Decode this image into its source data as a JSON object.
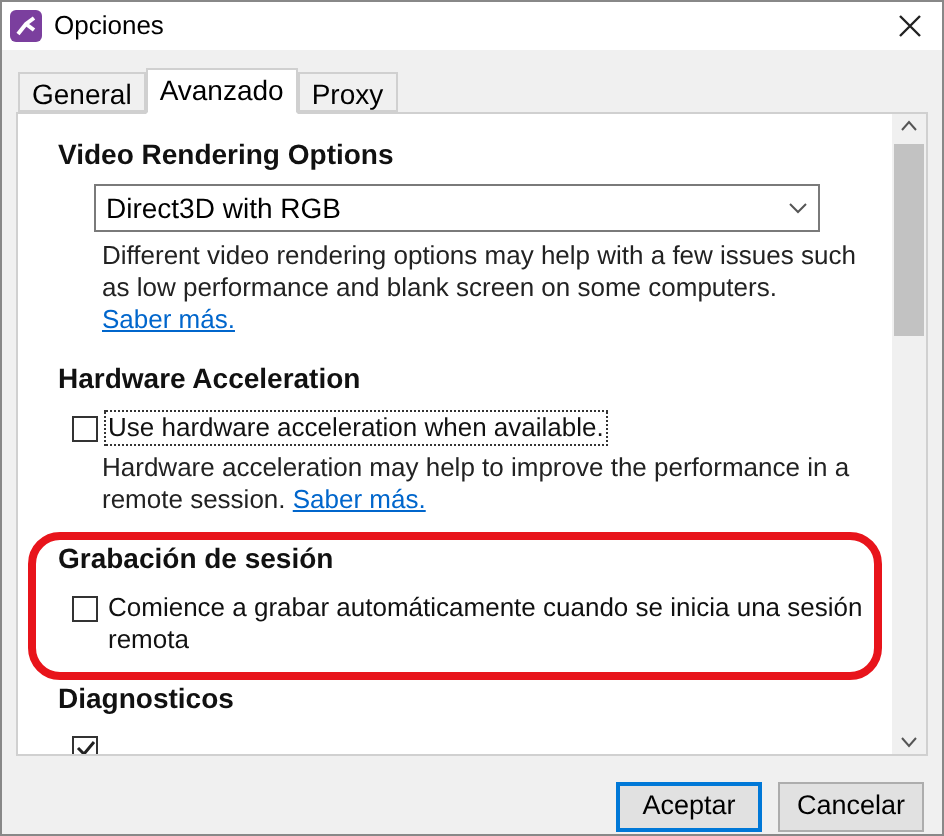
{
  "window": {
    "title": "Opciones"
  },
  "tabs": [
    {
      "label": "General",
      "selected": false
    },
    {
      "label": "Avanzado",
      "selected": true
    },
    {
      "label": "Proxy",
      "selected": false
    }
  ],
  "sections": [
    {
      "heading": "Video Rendering Options",
      "items": [
        {
          "kind": "dropdown",
          "value": "Direct3D with RGB"
        },
        {
          "kind": "note",
          "text": "Different video rendering options may help with a few issues such as low performance and blank screen on some computers. ",
          "link": "Saber más."
        }
      ]
    },
    {
      "heading": "Hardware Acceleration",
      "items": [
        {
          "kind": "checkbox",
          "label": "Use hardware acceleration when available.",
          "checked": false,
          "focused": true
        },
        {
          "kind": "note",
          "text": "Hardware acceleration may help to improve the performance in a remote session. ",
          "link": "Saber más."
        }
      ]
    },
    {
      "heading": "Grabación de sesión",
      "highlighted": true,
      "items": [
        {
          "kind": "checkbox",
          "label": "Comience a grabar automáticamente cuando se inicia una sesión remota",
          "checked": false,
          "focused": false
        }
      ]
    },
    {
      "heading": "Diagnosticos",
      "items": [
        {
          "kind": "checkbox",
          "checked": true
        }
      ]
    }
  ],
  "buttons": [
    {
      "label": "Aceptar",
      "default": true
    },
    {
      "label": "Cancelar",
      "default": false
    }
  ]
}
